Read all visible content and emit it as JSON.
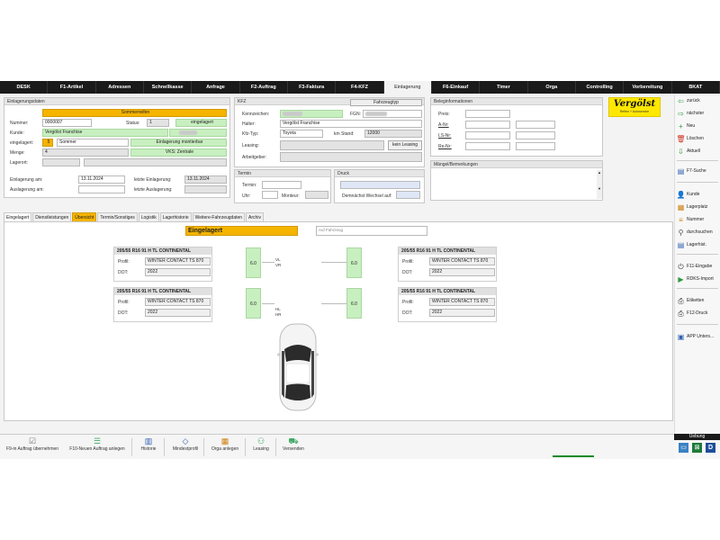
{
  "menu": [
    "DESK",
    "F1-Artikel",
    "Adressen",
    "Schnellkasse",
    "Anfrage",
    "F2-Auftrag",
    "F3-Faktura",
    "F4-KFZ",
    "Einlagerung",
    "F6-Einkauf",
    "Timer",
    "Orga",
    "Controlling",
    "Vorbereitung",
    "BKAT"
  ],
  "menu_active": "Einlagerung",
  "einlagerungsdaten": {
    "title": "Einlagerungsdaten",
    "banner": "Sommerreifen",
    "nummer_label": "Nummer:",
    "nummer": "0000007",
    "status_label": "Status:",
    "status_num": "1",
    "status_value": "eingelagert",
    "kunde_label": "Kunde:",
    "kunde": "Vergölst Franchise",
    "eingelagert_label": "eingelagert:",
    "eingelagert_num": "5",
    "eingelagert_value": "Sommer",
    "montierbar": "Einlagerung montierbar",
    "menge_label": "Menge:",
    "menge": "4",
    "vks": "VKS: Zentrale",
    "lagerort_label": "Lagerort:",
    "einlagerung_am_label": "Einlagerung am:",
    "einlagerung_am": "13.11.2024",
    "letzte_einlagerung_label": "letzte Einlagerung:",
    "letzte_einlagerung": "13.11.2024",
    "auslagerung_am_label": "Auslagerung am:",
    "letzte_auslagerung_label": "letzte Auslagerung:"
  },
  "kfz": {
    "title": "KFZ",
    "fahrzeugtyp_button": "Fahrzeugtyp",
    "kennzeichen_label": "Kennzeichen:",
    "fgn_label": "FGN:",
    "halter_label": "Halter:",
    "halter": "Vergölst Franchise",
    "kfztyp_label": "Kfz-Typ:",
    "kfztyp": "Toyota",
    "kmstand_label": "km Stand:",
    "kmstand": "12000",
    "leasing_label": "Leasing:",
    "leasing_button": "kein Leasing",
    "arbeitgeber_label": "Arbeitgeber:"
  },
  "termin": {
    "title": "Termin",
    "termin_label": "Termin:",
    "uhr_label": "Uhr:",
    "monteur_label": "Monteur:"
  },
  "druck": {
    "title": "Druck",
    "wechsel": "Demnächst Wechsel auf:"
  },
  "beleg": {
    "title": "Beleginformationen",
    "preis_label": "Preis:",
    "anr_label": "A-Nr:",
    "lsnr_label": "LS-Nr:",
    "renr_label": "Re-Nr:"
  },
  "maengel": {
    "title": "Mängel/Bemerkungen"
  },
  "logo": {
    "text": "Vergölst",
    "sub": "Reifen + Autoservice"
  },
  "tabs": [
    "Eingelagert",
    "Dienstleistungen",
    "Übersicht",
    "Termin/Sonstiges",
    "Logistik",
    "Lagerhistorie",
    "Weitere-Fahrzeugdaten",
    "Archiv"
  ],
  "overview": {
    "status": "Eingelagert",
    "aufnahme_placeholder": "Auf Fahrzeug",
    "tires": [
      {
        "size": "205/55 R16 91 H  TL CONTINENTAL",
        "profil_label": "Profil:",
        "profil": "WINTER CONTACT TS 870",
        "dot_label": "DOT:",
        "dot": "2022"
      },
      {
        "size": "205/55 R16 91 H  TL CONTINENTAL",
        "profil_label": "Profil:",
        "profil": "WINTER CONTACT TS 870",
        "dot_label": "DOT:",
        "dot": "2022"
      },
      {
        "size": "205/55 R16 91 H  TL CONTINENTAL",
        "profil_label": "Profil:",
        "profil": "WINTER CONTACT TS 870",
        "dot_label": "DOT:",
        "dot": "2022"
      },
      {
        "size": "205/55 R16 91 H  TL CONTINENTAL",
        "profil_label": "Profil:",
        "profil": "WINTER CONTACT TS 870",
        "dot_label": "DOT:",
        "dot": "2022"
      }
    ],
    "pressures": [
      "6.0",
      "6.0",
      "6.0",
      "6.0"
    ],
    "axles": [
      "VL",
      "VR",
      "HL",
      "HR"
    ]
  },
  "sidebar": [
    {
      "label": "zurück",
      "icon": "arrow-left-icon",
      "color": "#2a9a3a"
    },
    {
      "label": "nächster",
      "icon": "arrow-right-icon",
      "color": "#2a9a3a"
    },
    {
      "label": "Neu",
      "icon": "plus-icon",
      "color": "#2a9a3a"
    },
    {
      "label": "Löschen",
      "icon": "trash-icon",
      "color": "#d03020"
    },
    {
      "label": "Aktuell",
      "icon": "arrow-down-icon",
      "color": "#2a9a3a"
    },
    {
      "label": "F7-Suche",
      "icon": "search-doc-icon",
      "color": "#3060b0"
    },
    {
      "label": "Kunde",
      "icon": "person-icon",
      "color": "#3060b0"
    },
    {
      "label": "Lagerplatz",
      "icon": "clipboard-icon",
      "color": "#d08010"
    },
    {
      "label": "Nummer",
      "icon": "list-icon",
      "color": "#d08010"
    },
    {
      "label": "durchsuchen",
      "icon": "search-icon",
      "color": "#555"
    },
    {
      "label": "Lagerhist.",
      "icon": "history-icon",
      "color": "#3060b0"
    },
    {
      "label": "F11-Eingabe",
      "icon": "power-icon",
      "color": "#333"
    },
    {
      "label": "RDKS-Import",
      "icon": "play-icon",
      "color": "#2a9a3a"
    },
    {
      "label": "Etiketten",
      "icon": "printer-icon",
      "color": "#333"
    },
    {
      "label": "F12-Druck",
      "icon": "printer-icon",
      "color": "#333"
    },
    {
      "label": "APP Unters...",
      "icon": "app-icon",
      "color": "#3060b0"
    }
  ],
  "bottom": [
    {
      "label": "F9-in Auftrag übernehmen",
      "icon": "check-box-icon"
    },
    {
      "label": "F10-Neuen Auftrag anlegen",
      "icon": "new-order-icon"
    },
    {
      "label": "Historie",
      "icon": "bar-chart-icon"
    },
    {
      "label": "Mindestprofil",
      "icon": "tag-icon"
    },
    {
      "label": "Orga anlegen",
      "icon": "calendar-icon"
    },
    {
      "label": "Leasing",
      "icon": "handshake-icon"
    },
    {
      "label": "Versenden",
      "icon": "truck-icon"
    }
  ],
  "status_right": {
    "label": "Uebung"
  }
}
